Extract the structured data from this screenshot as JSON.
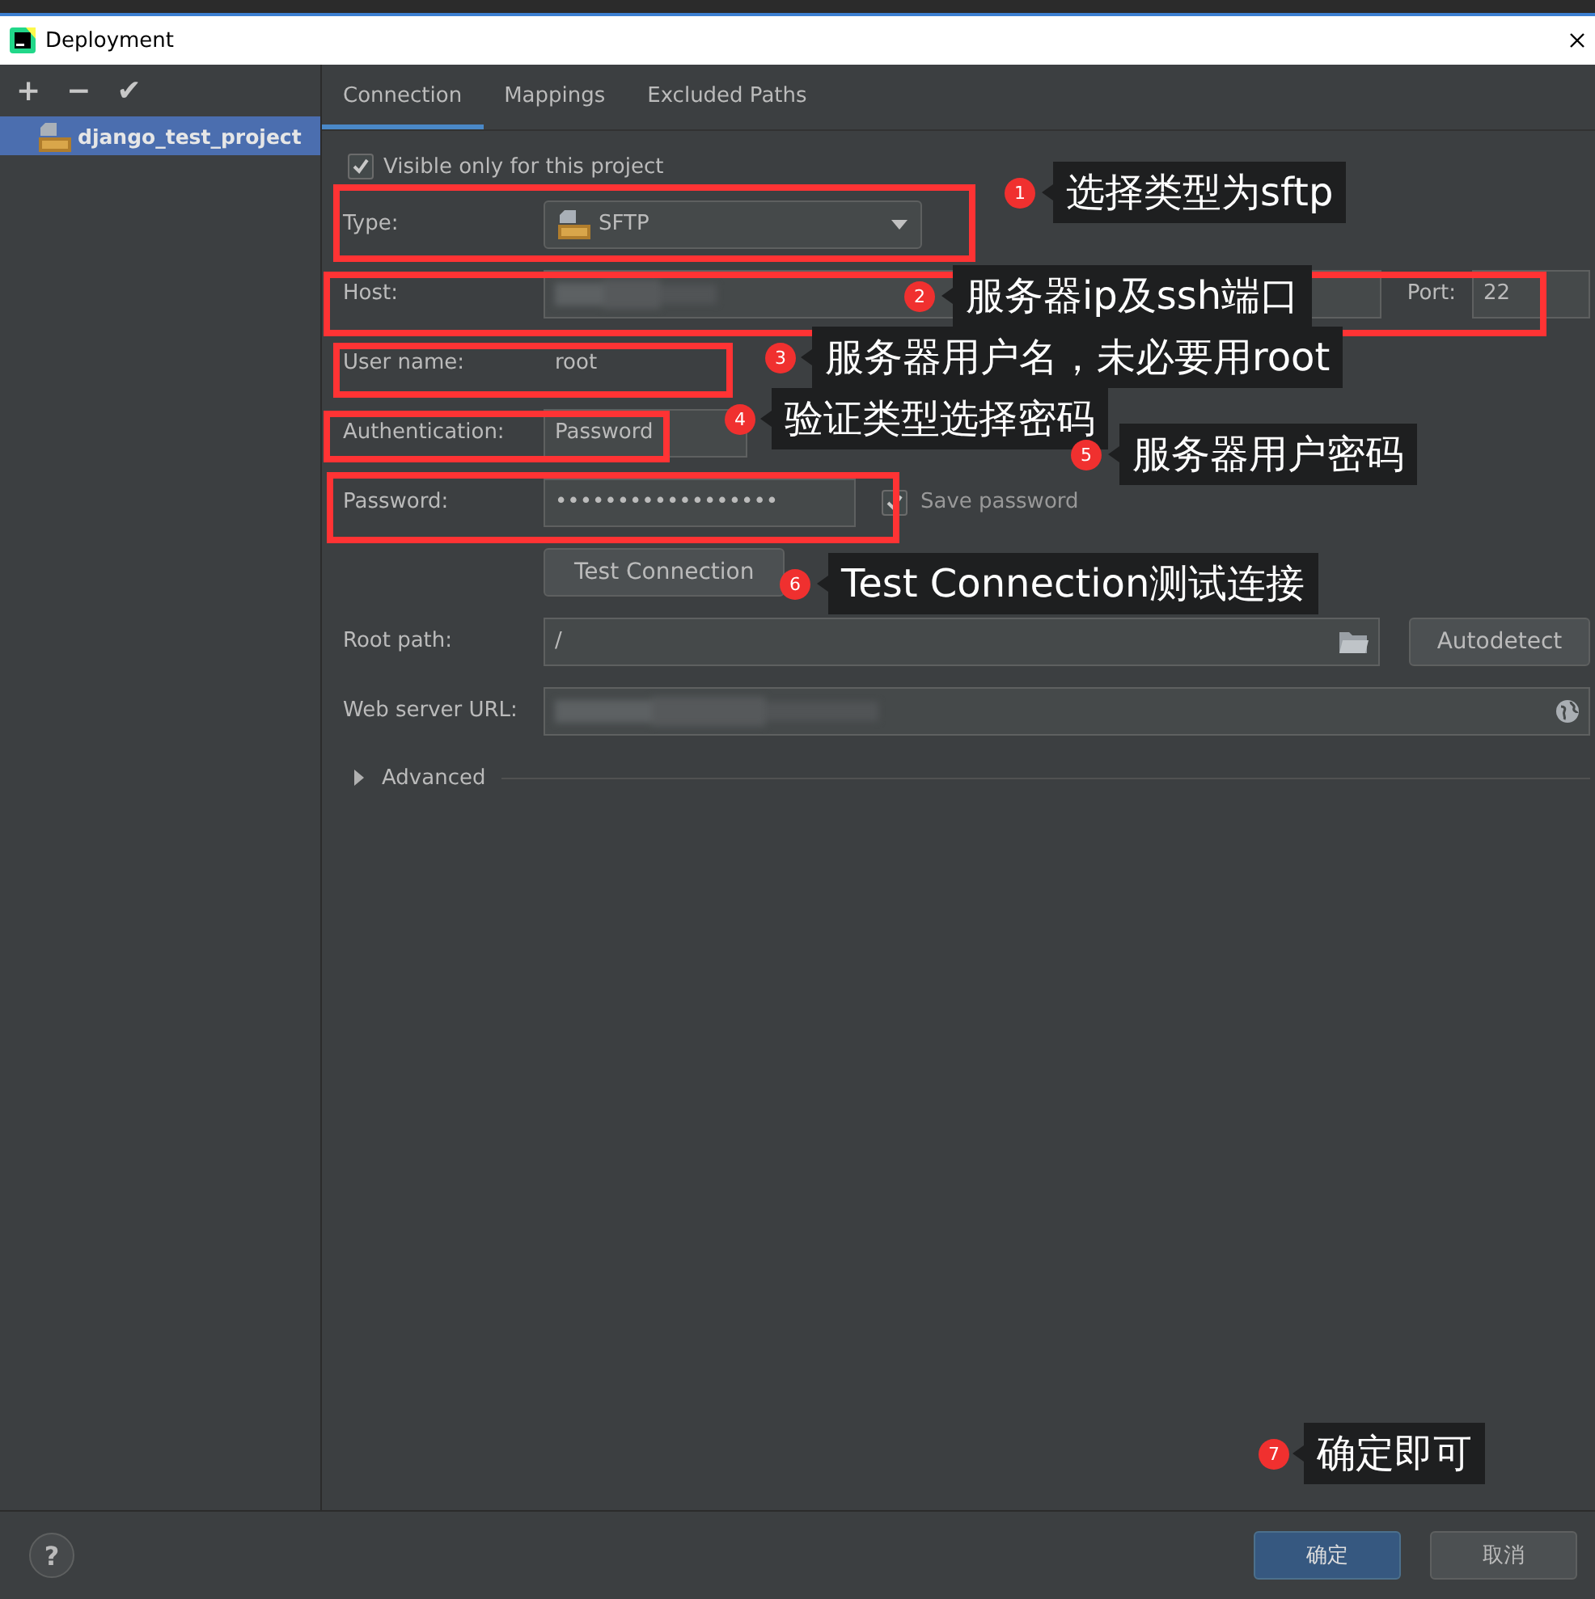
{
  "window": {
    "title": "Deployment"
  },
  "toolbar": [
    "+",
    "−",
    "✔"
  ],
  "servers": [
    {
      "name": "django_test_project",
      "selected": true
    }
  ],
  "tabs": [
    {
      "label": "Connection",
      "selected": true
    },
    {
      "label": "Mappings",
      "selected": false
    },
    {
      "label": "Excluded Paths",
      "selected": false
    }
  ],
  "visible_only": {
    "label": "Visible only for this project",
    "checked": true
  },
  "form": {
    "type": {
      "label": "Type:",
      "value": "SFTP"
    },
    "host": {
      "label": "Host:"
    },
    "port": {
      "label": "Port:",
      "value": "22"
    },
    "user_name": {
      "label": "User name:",
      "value": "root"
    },
    "authentication": {
      "label": "Authentication:",
      "value": "Password"
    },
    "password": {
      "label": "Password:",
      "value": "••••••••••••••••••"
    },
    "save_password": {
      "label": "Save password",
      "checked": true
    },
    "test_button": "Test Connection",
    "root_path": {
      "label": "Root path:",
      "value": "/"
    },
    "autodetect_button": "Autodetect",
    "web_server_url": {
      "label": "Web server URL:"
    },
    "advanced": {
      "label": "Advanced",
      "expanded": false
    }
  },
  "help_button": "?",
  "buttons": [
    {
      "label": "确定",
      "kind": "primary"
    },
    {
      "label": "取消",
      "kind": "secondary"
    }
  ],
  "annotations": [
    {
      "number": "1",
      "text": "选择类型为sftp"
    },
    {
      "number": "2",
      "text": "服务器ip及ssh端口"
    },
    {
      "number": "3",
      "text": "服务器用户名，未必要用root"
    },
    {
      "number": "4",
      "text": "验证类型选择密码"
    },
    {
      "number": "5",
      "text": "服务器用户密码"
    },
    {
      "number": "6",
      "text": "Test Connection测试连接"
    },
    {
      "number": "7",
      "text": "确定即可"
    }
  ]
}
